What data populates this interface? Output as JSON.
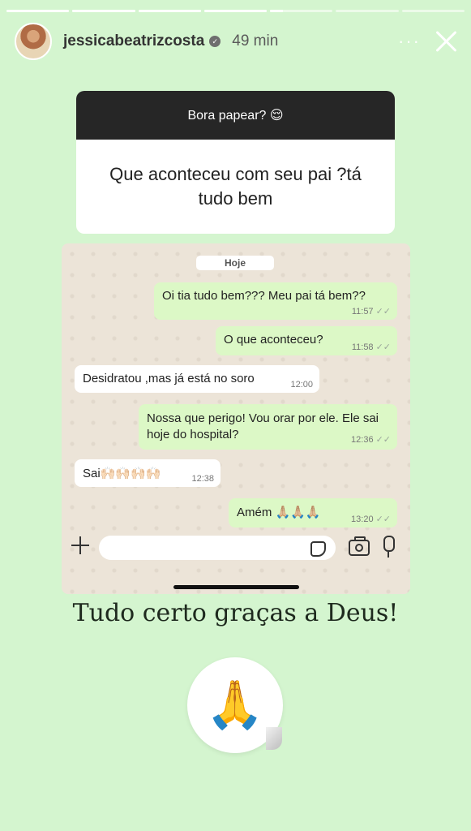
{
  "story": {
    "progress": [
      1,
      1,
      1,
      1,
      0.2,
      0,
      0
    ],
    "username": "jessicabeatrizcosta",
    "time_ago": "49 min",
    "more_icon": "···",
    "verified_icon": "✓"
  },
  "question": {
    "title": "Bora papear? 😌",
    "text": "Que aconteceu com seu pai ?tá tudo bem"
  },
  "chat": {
    "day_label": "Hoje",
    "messages": [
      {
        "text": "Oi tia tudo bem??? Meu pai tá bem??",
        "time": "11:57",
        "dir": "out"
      },
      {
        "text": "O que aconteceu?",
        "time": "11:58",
        "dir": "out"
      },
      {
        "text": "Desidratou ,mas já está no soro",
        "time": "12:00",
        "dir": "in"
      },
      {
        "text": "Nossa que perigo! Vou orar por ele. Ele sai hoje do hospital?",
        "time": "12:36",
        "dir": "out"
      },
      {
        "text": "Sai🙌🏻🙌🏻🙌🏻🙌🏻",
        "time": "12:38",
        "dir": "in"
      },
      {
        "text": "Amém 🙏🏼🙏🏼🙏🏼",
        "time": "13:20",
        "dir": "out"
      }
    ],
    "ticks": "✓✓"
  },
  "caption": "Tudo certo graças a Deus!",
  "emoji": "🙏"
}
